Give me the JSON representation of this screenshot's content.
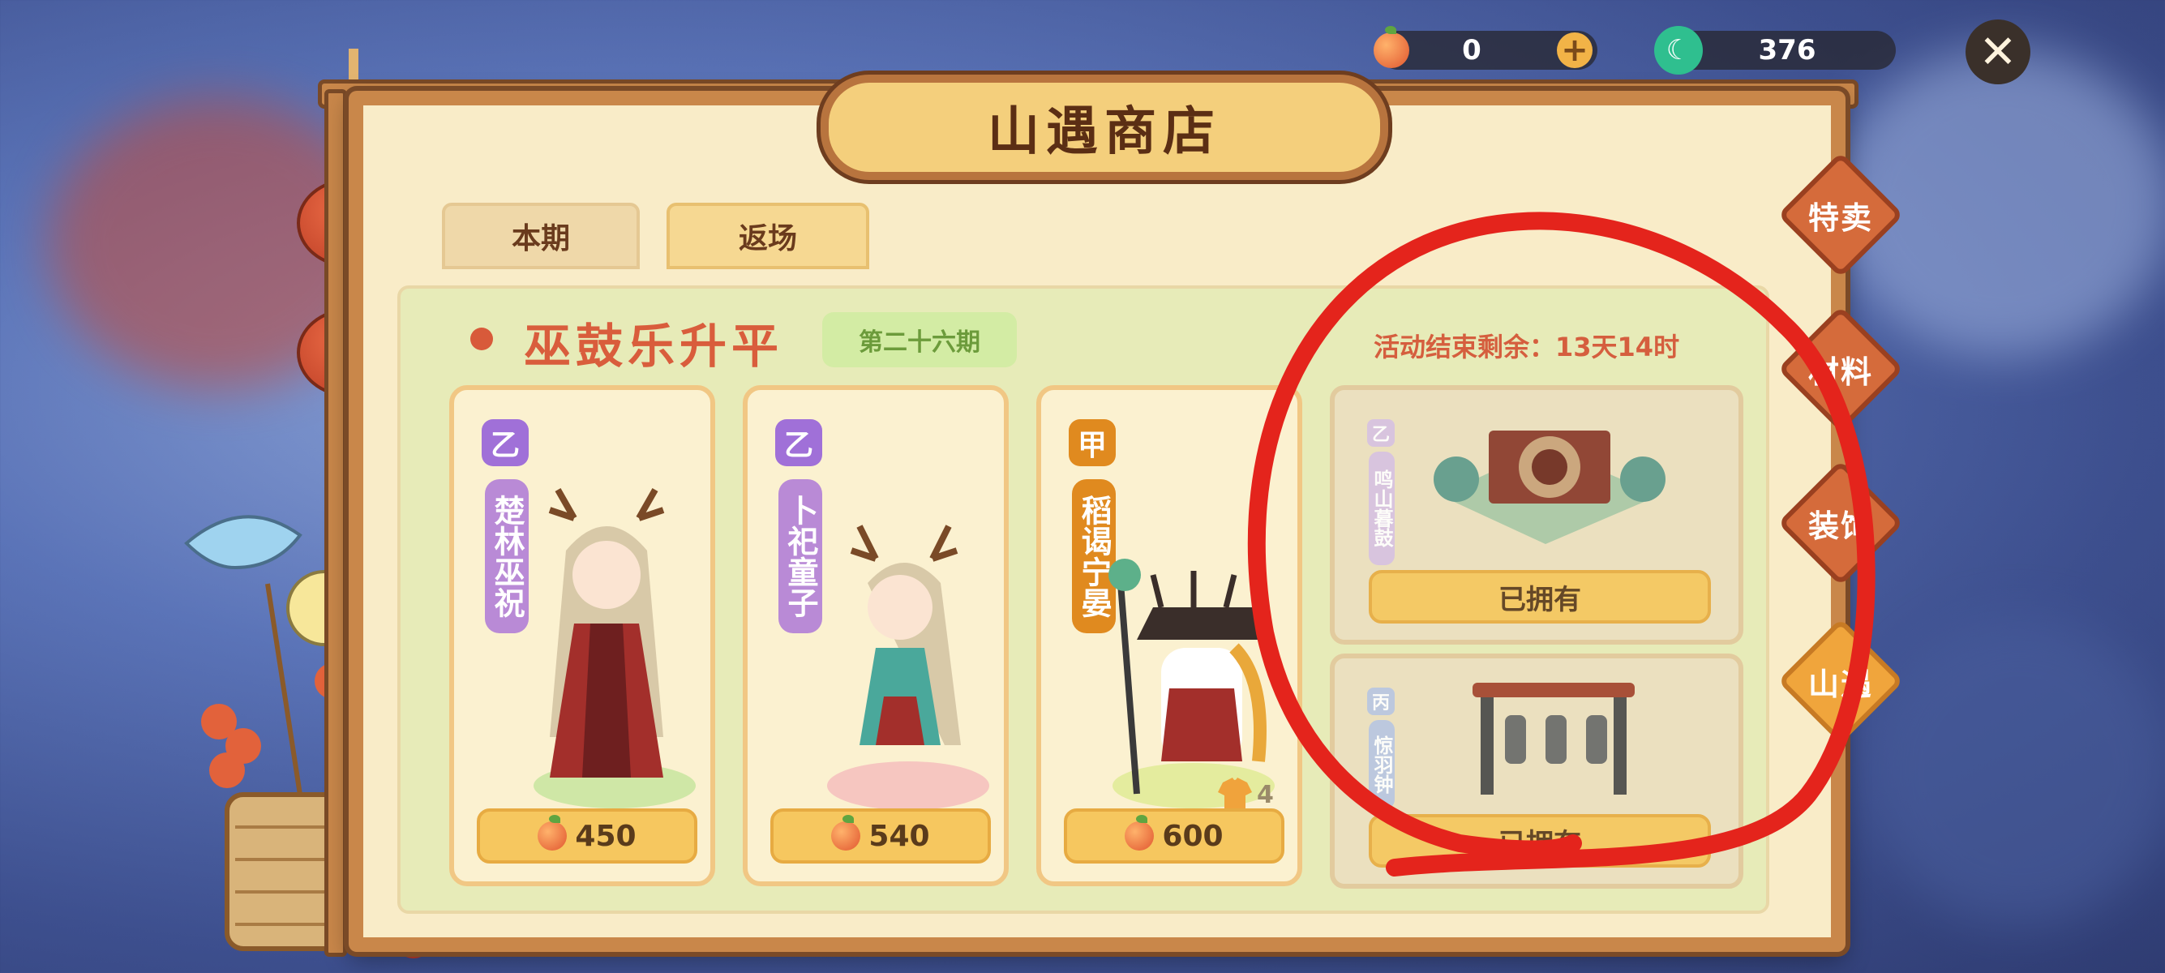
{
  "resources": {
    "peach_count": "0",
    "jade_count": "376"
  },
  "shop": {
    "title": "山遇商店",
    "tabs": [
      {
        "label": "本期"
      },
      {
        "label": "返场"
      }
    ],
    "active_tab": "返场"
  },
  "event": {
    "title": "巫鼓乐升平",
    "period": "第二十六期",
    "timer": "活动结束剩余：13天14时"
  },
  "cards": [
    {
      "grade": "乙",
      "name": "楚林巫祝",
      "price": "450",
      "grade_color": "#a070d8"
    },
    {
      "grade": "乙",
      "name": "卜祀童子",
      "price": "540",
      "grade_color": "#a070d8"
    },
    {
      "grade": "甲",
      "name": "稻谒宁晏",
      "price": "600",
      "grade_color": "#e08a1f",
      "extra_count": "4"
    }
  ],
  "furniture": [
    {
      "grade": "乙",
      "name": "鸣山暮鼓",
      "status": "已拥有"
    },
    {
      "grade": "丙",
      "name": "惊羽钟",
      "status": "已拥有"
    }
  ],
  "side_tabs": [
    {
      "label": "特卖",
      "active": false
    },
    {
      "label": "材料",
      "active": false
    },
    {
      "label": "装饰",
      "active": false
    },
    {
      "label": "山遇",
      "active": true
    }
  ],
  "colors": {
    "accent_red": "#d85a3a",
    "frame_wood": "#c9874a",
    "button_gold": "#f6c75f",
    "annotation_red": "#e4241c"
  },
  "icons": [
    "peach-icon",
    "jade-icon",
    "plus-icon",
    "close-icon"
  ]
}
